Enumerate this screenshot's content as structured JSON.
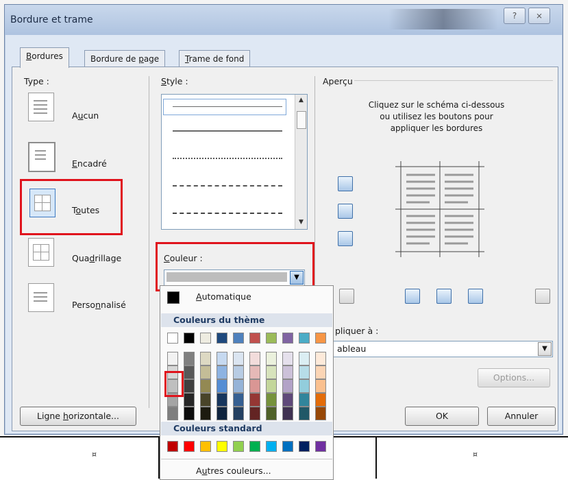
{
  "dialog": {
    "title": "Bordure et trame",
    "help_label": "?",
    "close_label": "⨯",
    "tabs": [
      {
        "label": "Bordures",
        "underline": "B",
        "rest": "ordures"
      },
      {
        "label": "Bordure de page",
        "pre": "Bordure de ",
        "underline": "p",
        "rest": "age"
      },
      {
        "label": "Trame de fond",
        "underline": "T",
        "rest": "rame de fond"
      }
    ]
  },
  "type_section": {
    "label": "Type :",
    "items": [
      {
        "pre": "A",
        "u": "u",
        "rest": "cun"
      },
      {
        "pre": "",
        "u": "E",
        "rest": "ncadré"
      },
      {
        "pre": "T",
        "u": "o",
        "rest": "utes"
      },
      {
        "pre": "Qua",
        "u": "d",
        "rest": "rillage"
      },
      {
        "pre": "Perso",
        "u": "n",
        "rest": "nalisé"
      }
    ]
  },
  "style_section": {
    "pre": "",
    "u": "S",
    "rest": "tyle :"
  },
  "color_section": {
    "pre": "",
    "u": "C",
    "rest": "ouleur :",
    "selected_color": "#bdbdbd"
  },
  "palette": {
    "automatic_pre": "",
    "automatic_u": "A",
    "automatic_rest": "utomatique",
    "theme_header": "Couleurs du thème",
    "standard_header": "Couleurs standard",
    "more_pre": "A",
    "more_u": "u",
    "more_rest": "tres couleurs...",
    "theme_columns": [
      [
        "#ffffff",
        "#f2f2f2",
        "#d8d8d8",
        "#bfbfbf",
        "#a5a5a5",
        "#7f7f7f"
      ],
      [
        "#000000",
        "#7f7f7f",
        "#595959",
        "#3f3f3f",
        "#262626",
        "#0c0c0c"
      ],
      [
        "#eeece1",
        "#ddd9c3",
        "#c4bd97",
        "#938953",
        "#494429",
        "#1d1b10"
      ],
      [
        "#1f497d",
        "#c6d9f0",
        "#8db3e2",
        "#548dd4",
        "#17365d",
        "#0f243e"
      ],
      [
        "#4f81bd",
        "#dbe5f1",
        "#b8cce4",
        "#95b3d7",
        "#366092",
        "#244061"
      ],
      [
        "#c0504d",
        "#f2dcdb",
        "#e5b9b7",
        "#d99694",
        "#953734",
        "#632423"
      ],
      [
        "#9bbb59",
        "#ebf1dd",
        "#d7e3bc",
        "#c3d69b",
        "#76923c",
        "#4f6128"
      ],
      [
        "#8064a2",
        "#e5e0ec",
        "#ccc1d9",
        "#b2a2c7",
        "#5f497a",
        "#3f3151"
      ],
      [
        "#4bacc6",
        "#dbeef3",
        "#b7dde8",
        "#92cddc",
        "#31859b",
        "#205867"
      ],
      [
        "#f79646",
        "#fdeada",
        "#fbd5b5",
        "#fac08f",
        "#e36c09",
        "#974806"
      ]
    ],
    "standard_colors": [
      "#c00000",
      "#ff0000",
      "#ffc000",
      "#ffff00",
      "#92d050",
      "#00b050",
      "#00b0f0",
      "#0070c0",
      "#002060",
      "#7030a0"
    ]
  },
  "preview": {
    "label": "Aperçu",
    "instructions_1": "Cliquez sur le schéma ci-dessous",
    "instructions_2": "ou utilisez les boutons pour",
    "instructions_3": "appliquer les bordures"
  },
  "apply": {
    "label_visible": "pliquer à :",
    "value_visible": "ableau",
    "options_label": "Options..."
  },
  "buttons": {
    "horizontal_pre": "Ligne ",
    "horizontal_u": "h",
    "horizontal_rest": "orizontale...",
    "ok": "OK",
    "cancel": "Annuler"
  },
  "document": {
    "cell_mark": "¤"
  }
}
